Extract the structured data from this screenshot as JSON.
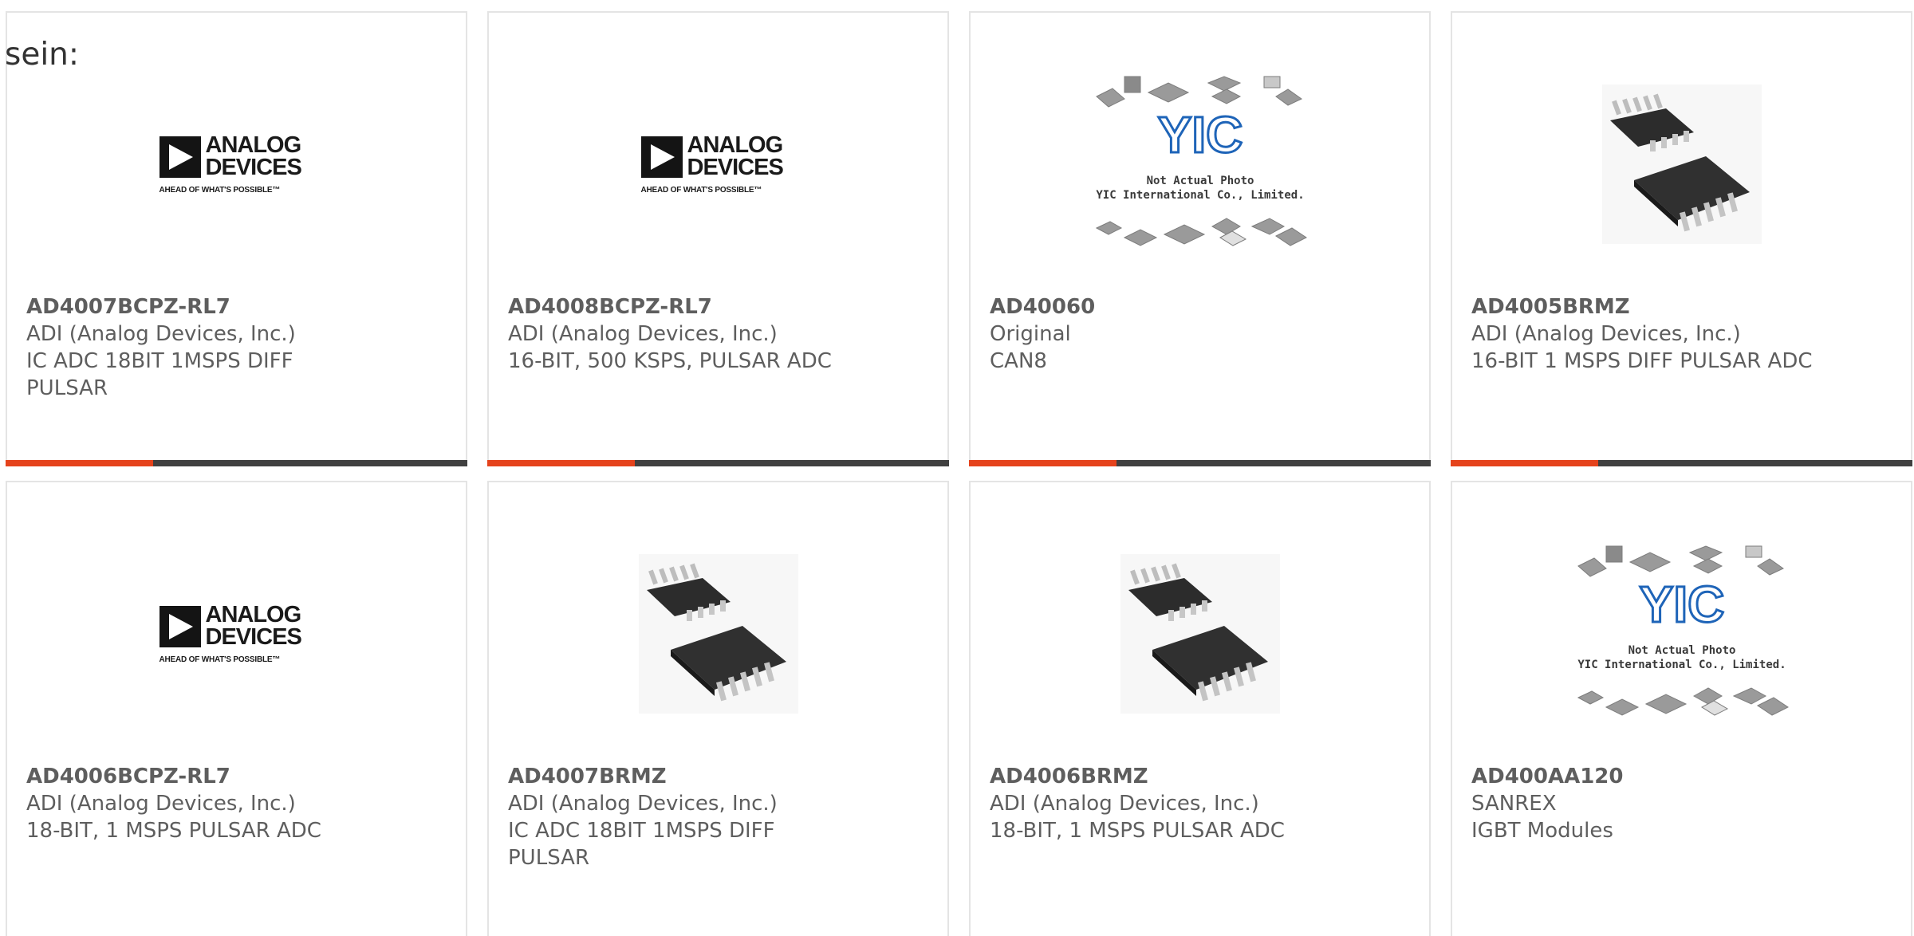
{
  "lead_text": "sein:",
  "colors": {
    "accent": "#e5431c",
    "bar": "#404040",
    "border": "#e4e4e4"
  },
  "logos": {
    "analog_devices": {
      "line1": "ANALOG",
      "line2": "DEVICES",
      "tagline": "AHEAD OF WHAT'S POSSIBLE™"
    },
    "yic": {
      "mark": "YIC",
      "caption1": "Not Actual Photo",
      "caption2": "YIC International Co., Limited."
    }
  },
  "products": [
    {
      "part": "AD4007BCPZ-RL7",
      "manufacturer": "ADI (Analog Devices, Inc.)",
      "desc1": "IC ADC 18BIT 1MSPS DIFF",
      "desc2": "PULSAR",
      "image": "analog-devices-logo"
    },
    {
      "part": "AD4008BCPZ-RL7",
      "manufacturer": "ADI (Analog Devices, Inc.)",
      "desc1": "16-BIT, 500 KSPS, PULSAR ADC",
      "desc2": "",
      "image": "analog-devices-logo"
    },
    {
      "part": "AD40060",
      "manufacturer": "Original",
      "desc1": "CAN8",
      "desc2": "",
      "image": "yic-placeholder"
    },
    {
      "part": "AD4005BRMZ",
      "manufacturer": "ADI (Analog Devices, Inc.)",
      "desc1": "16-BIT 1 MSPS DIFF PULSAR ADC",
      "desc2": "",
      "image": "msop-chip-photo"
    },
    {
      "part": "AD4006BCPZ-RL7",
      "manufacturer": "ADI (Analog Devices, Inc.)",
      "desc1": "18-BIT, 1 MSPS PULSAR ADC",
      "desc2": "",
      "image": "analog-devices-logo"
    },
    {
      "part": "AD4007BRMZ",
      "manufacturer": "ADI (Analog Devices, Inc.)",
      "desc1": "IC ADC 18BIT 1MSPS DIFF",
      "desc2": "PULSAR",
      "image": "msop-chip-photo"
    },
    {
      "part": "AD4006BRMZ",
      "manufacturer": "ADI (Analog Devices, Inc.)",
      "desc1": "18-BIT, 1 MSPS PULSAR ADC",
      "desc2": "",
      "image": "msop-chip-photo"
    },
    {
      "part": "AD400AA120",
      "manufacturer": "SANREX",
      "desc1": "IGBT Modules",
      "desc2": "",
      "image": "yic-placeholder"
    }
  ]
}
